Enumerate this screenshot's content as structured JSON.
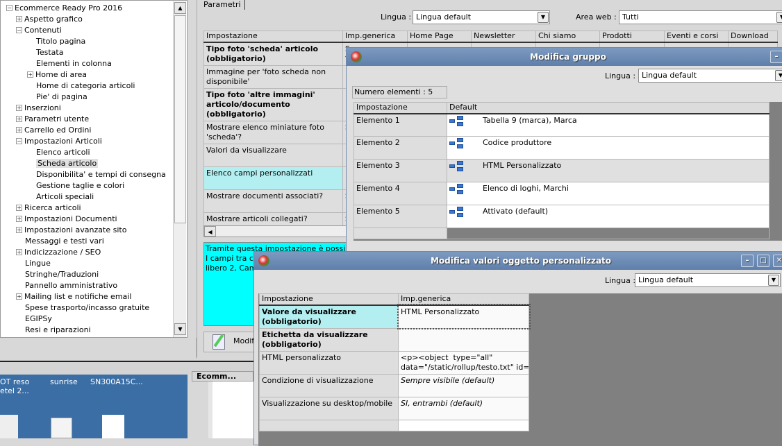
{
  "tree": {
    "items": [
      {
        "label": "Ecommerce Ready Pro 2016",
        "level": 0,
        "expander": "minus"
      },
      {
        "label": "Aspetto grafico",
        "level": 1,
        "expander": "plus"
      },
      {
        "label": "Contenuti",
        "level": 1,
        "expander": "minus"
      },
      {
        "label": "Titolo pagina",
        "level": 2
      },
      {
        "label": "Testata",
        "level": 2
      },
      {
        "label": "Elementi in colonna",
        "level": 2
      },
      {
        "label": "Home di area",
        "level": 2,
        "expander": "plus"
      },
      {
        "label": "Home di categoria articoli",
        "level": 2
      },
      {
        "label": "Pie' di pagina",
        "level": 2
      },
      {
        "label": "Inserzioni",
        "level": 1,
        "expander": "plus"
      },
      {
        "label": "Parametri utente",
        "level": 1,
        "expander": "plus"
      },
      {
        "label": "Carrello ed Ordini",
        "level": 1,
        "expander": "plus"
      },
      {
        "label": "Impostazioni Articoli",
        "level": 1,
        "expander": "minus"
      },
      {
        "label": "Elenco articoli",
        "level": 2
      },
      {
        "label": "Scheda articolo",
        "level": 2,
        "selected": true
      },
      {
        "label": "Disponibilita' e tempi di consegna",
        "level": 2
      },
      {
        "label": "Gestione taglie e colori",
        "level": 2
      },
      {
        "label": "Articoli speciali",
        "level": 2
      },
      {
        "label": "Ricerca articoli",
        "level": 1,
        "expander": "plus"
      },
      {
        "label": "Impostazioni Documenti",
        "level": 1,
        "expander": "plus"
      },
      {
        "label": "Impostazioni avanzate sito",
        "level": 1,
        "expander": "plus"
      },
      {
        "label": "Messaggi e testi vari",
        "level": 1
      },
      {
        "label": "Indicizzazione / SEO",
        "level": 1,
        "expander": "plus"
      },
      {
        "label": "Lingue",
        "level": 1
      },
      {
        "label": "Stringhe/Traduzioni",
        "level": 1
      },
      {
        "label": "Pannello amministrativo",
        "level": 1
      },
      {
        "label": "Mailing list e notifiche email",
        "level": 1,
        "expander": "plus"
      },
      {
        "label": "Spese trasporto/incasso gratuite",
        "level": 1
      },
      {
        "label": "EGIPSy",
        "level": 1
      },
      {
        "label": "Resi e riparazioni",
        "level": 1
      }
    ]
  },
  "main": {
    "tab": "Parametri",
    "lingua_label": "Lingua :",
    "lingua_value": "Lingua default",
    "area_label": "Area web :",
    "area_value": "Tutti",
    "columns": [
      "Impostazione",
      "Imp.generica",
      "Home Page",
      "Newsletter",
      "Chi siamo",
      "Prodotti",
      "Eventi e corsi",
      "Download"
    ],
    "rows": [
      {
        "label": "Tipo foto 'scheda' articolo (obbligatorio)",
        "bold": true,
        "value": "S\nv"
      },
      {
        "label": "Immagine per 'foto scheda non disponibile'",
        "value": "F\nE"
      },
      {
        "label": "Tipo foto 'altre immagini' articolo/documento (obbligatorio)",
        "bold": true,
        "value": "F"
      },
      {
        "label": "Mostrare elenco miniature foto 'scheda'?",
        "value": "S"
      },
      {
        "label": "Valori da visualizzare",
        "value": ""
      },
      {
        "label": "Elenco campi personalizzati",
        "value": "",
        "selected": true
      },
      {
        "label": "Mostrare documenti associati?",
        "value": "S"
      },
      {
        "label": "Mostrare articoli collegati?",
        "value": "S\n&"
      }
    ],
    "description": "Tramite questa impostazione è possibile\nI campi tra cui\nlibero 2, Camp",
    "edit_button": "Modifi"
  },
  "dialog_group": {
    "title": "Modifica gruppo",
    "lingua_label": "Lingua :",
    "lingua_value": "Lingua default",
    "count_label": "Numero elementi : 5",
    "columns": [
      "Impostazione",
      "Default"
    ],
    "rows": [
      {
        "label": "Elemento 1",
        "value": "Tabella 9 (marca), Marca"
      },
      {
        "label": "Elemento 2",
        "value": "Codice produttore"
      },
      {
        "label": "Elemento 3",
        "value": "HTML Personalizzato",
        "highlight": true
      },
      {
        "label": "Elemento 4",
        "value": "Elenco di loghi, Marchi"
      },
      {
        "label": "Elemento 5",
        "value": "Attivato (default)"
      }
    ]
  },
  "dialog_object": {
    "title": "Modifica valori oggetto personalizzato",
    "lingua_label": "Lingua :",
    "lingua_value": "Lingua default",
    "columns": [
      "Impostazione",
      "Imp.generica"
    ],
    "rows": [
      {
        "label": "Valore da visualizzare (obbligatorio)",
        "bold": true,
        "selected": true,
        "value": "HTML Personalizzato"
      },
      {
        "label": "Etichetta da visualizzare (obbligatorio)",
        "bold": true,
        "value": ""
      },
      {
        "label": "HTML personalizzato",
        "value": "<p><object  type=\"all\"\ndata=\"/static/rollup/testo.txt\" id=\"..."
      },
      {
        "label": "Condizione di visualizzazione",
        "value": "Sempre visibile (default)",
        "italic": true
      },
      {
        "label": "Visualizzazione su desktop/mobile",
        "value": "SI, entrambi (default)",
        "italic": true
      }
    ]
  },
  "desktop": {
    "icons": [
      "ОТ reso\netel 2...",
      "sunrise",
      "SN300A15C..."
    ],
    "taskbar_item": "Ecomm..."
  },
  "colors": {
    "selected_row": "#b3eff0",
    "description_bg": "#00ffff",
    "title_bar": "#6f8db5",
    "desktop": "#3a6ea5"
  }
}
